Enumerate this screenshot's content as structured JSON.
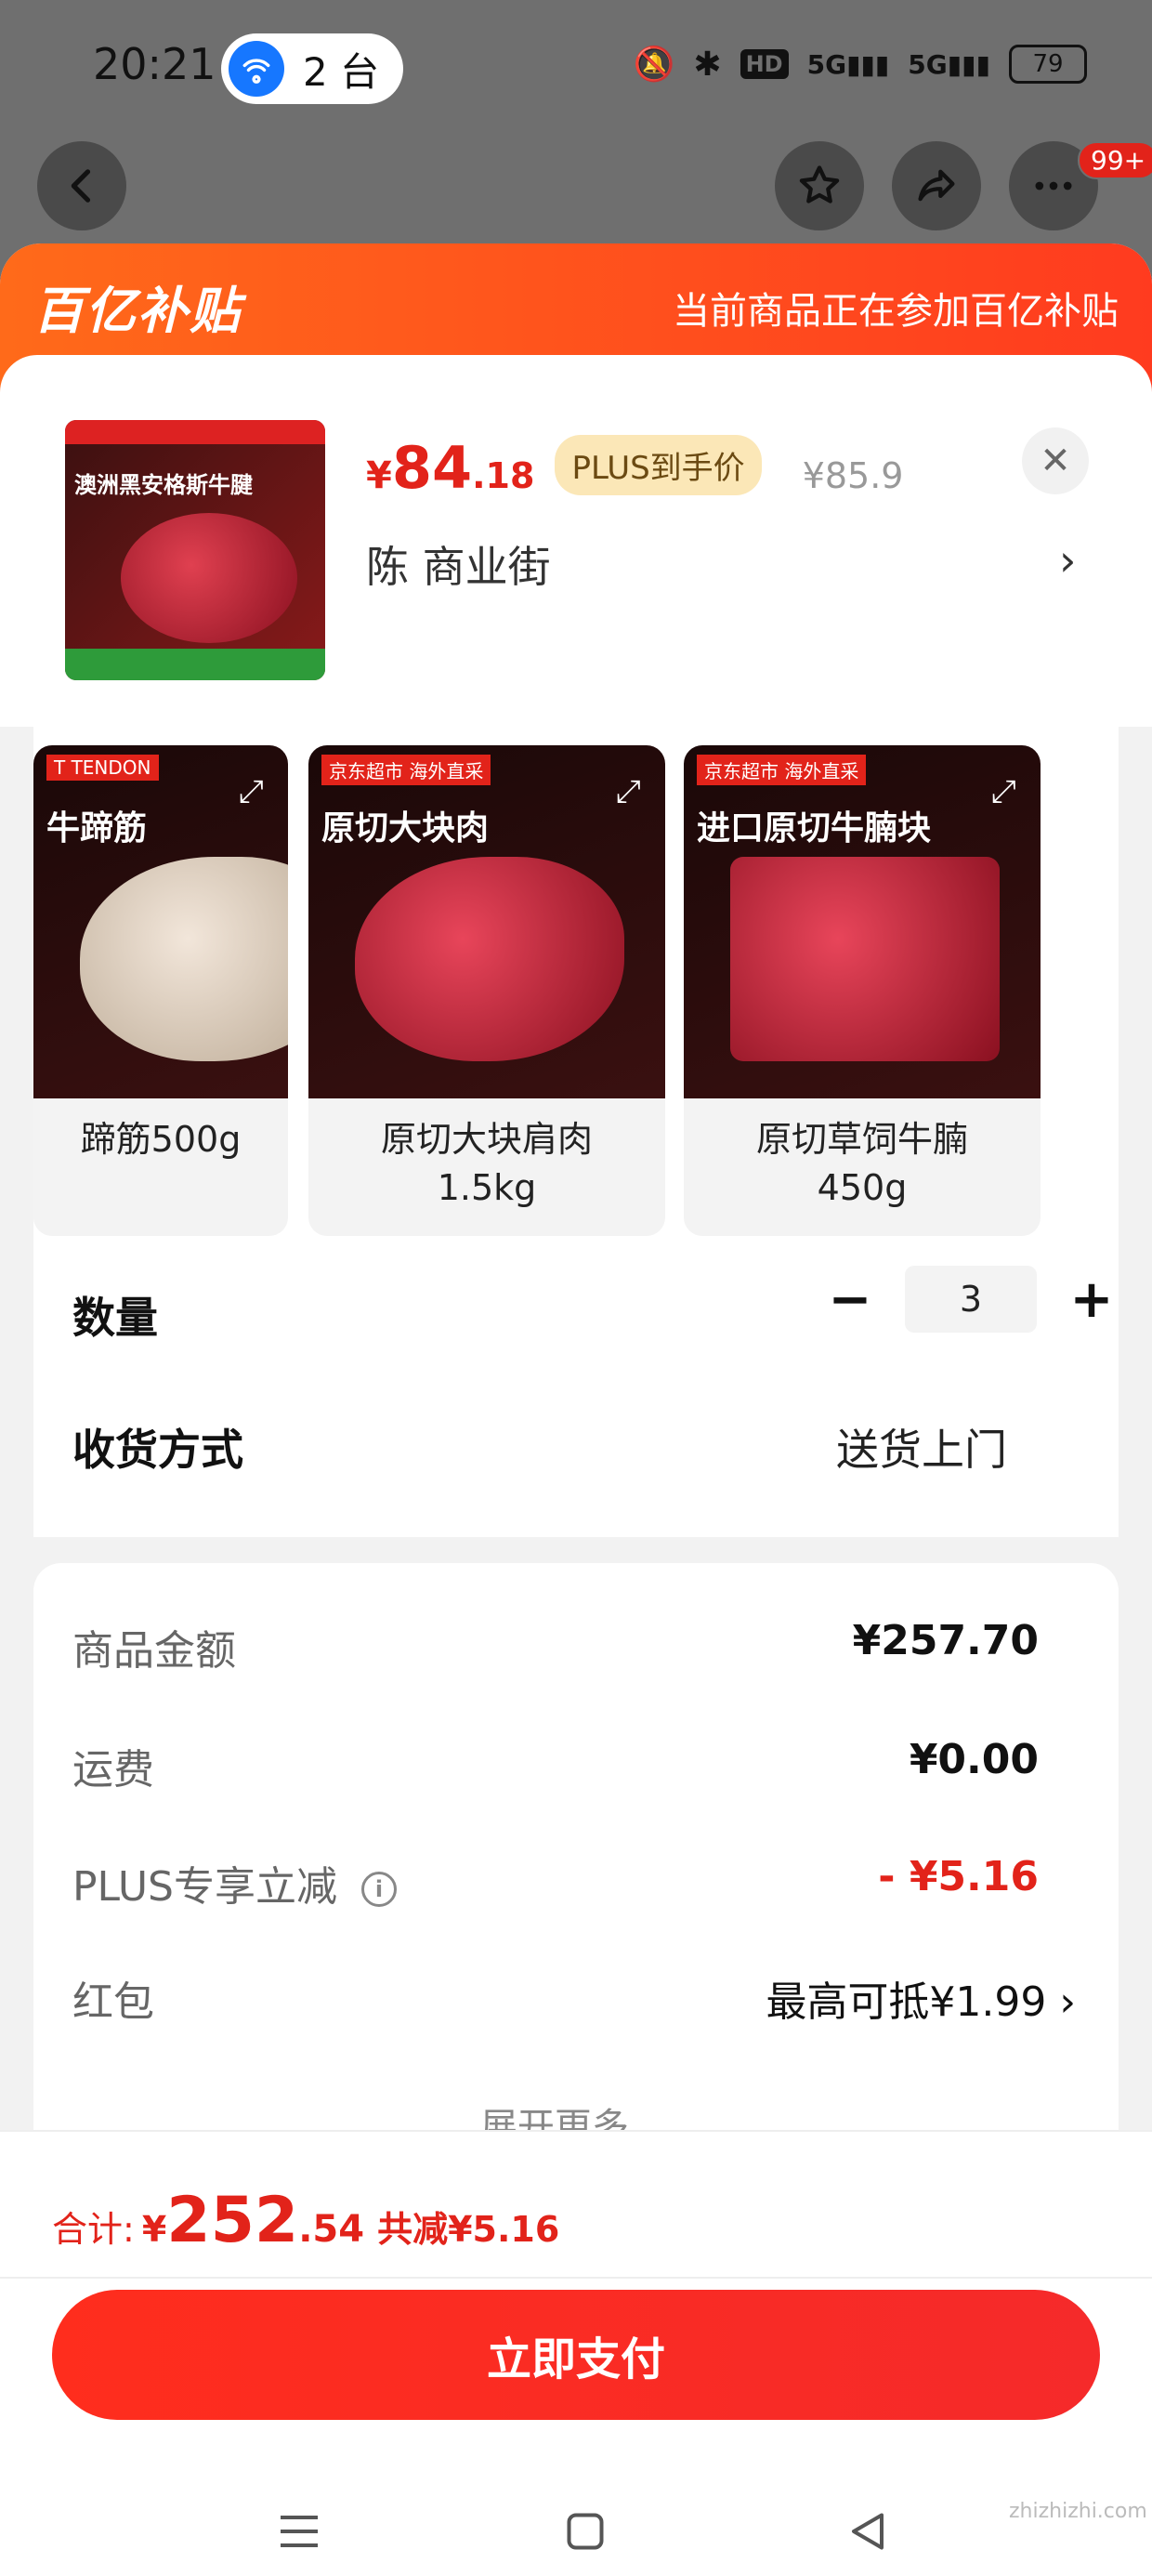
{
  "status_bar": {
    "time": "20:21",
    "hotspot_count": "2 台",
    "network": "5G",
    "battery": "79"
  },
  "top_nav": {
    "badge": "99+"
  },
  "banner": {
    "logo": "百亿补贴",
    "notice": "当前商品正在参加百亿补贴"
  },
  "product": {
    "image_title": "澳洲黑安格斯牛腱",
    "price_symbol": "¥",
    "price_int": "84",
    "price_dec": ".18",
    "plus_tag": "PLUS到手价",
    "original_price": "¥85.9",
    "address": "陈  商业街"
  },
  "variants": [
    {
      "label": "蹄筋500g",
      "image_title": "牛蹄筋",
      "tag": "T TENDON"
    },
    {
      "label": "原切大块肩肉\n1.5kg",
      "image_title": "原切大块肉",
      "tag": "京东超市 海外直采"
    },
    {
      "label": "原切草饲牛腩\n450g",
      "image_title": "进口原切牛腩块",
      "tag": "京东超市 海外直采"
    }
  ],
  "quantity": {
    "label": "数量",
    "value": "3",
    "minus": "−",
    "plus": "+"
  },
  "shipping": {
    "label": "收货方式",
    "value": "送货上门"
  },
  "summary": {
    "goods_label": "商品金额",
    "goods_value": "¥257.70",
    "freight_label": "运费",
    "freight_value": "¥0.00",
    "plus_label": "PLUS专享立减",
    "plus_value": "- ¥5.16",
    "redpacket_label": "红包",
    "redpacket_value": "最高可抵¥1.99",
    "expand_more": "展开更多"
  },
  "footer": {
    "total_label": "合计:",
    "total_symbol": "¥",
    "total_int": "252",
    "total_dec": ".54",
    "total_saved": "共减¥5.16",
    "pay_button": "立即支付"
  },
  "watermark": "zhizhizhi.com",
  "colors": {
    "accent": "#e2231a",
    "banner": "#ff5a1e",
    "plus_tag_bg": "#fbe7b7"
  }
}
